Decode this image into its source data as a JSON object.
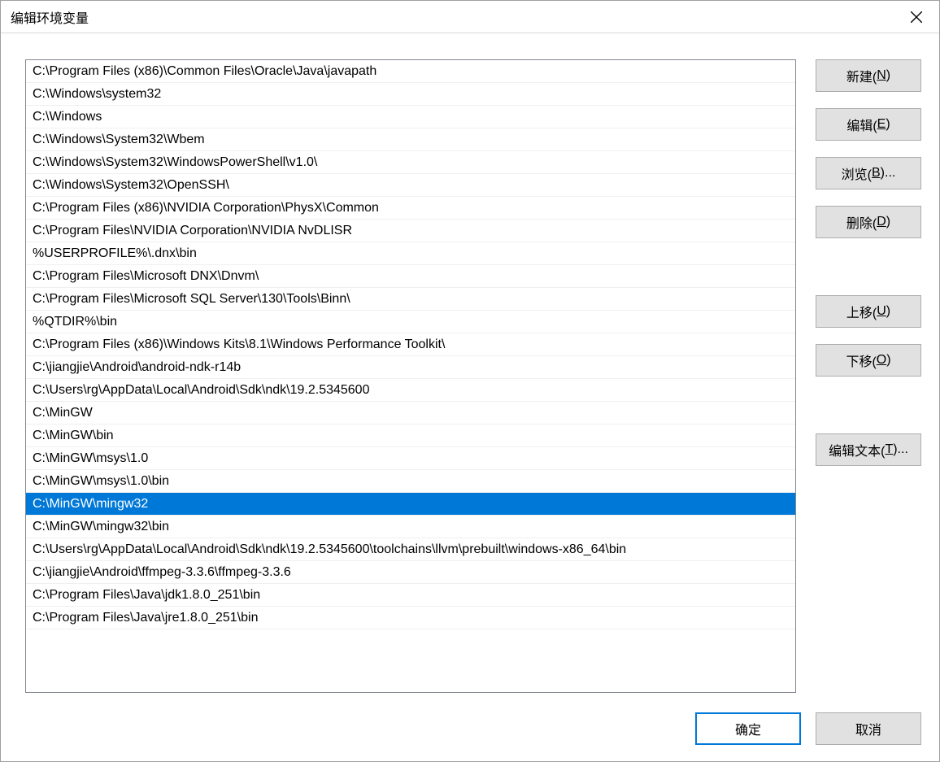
{
  "window": {
    "title": "编辑环境变量"
  },
  "paths": [
    "C:\\Program Files (x86)\\Common Files\\Oracle\\Java\\javapath",
    "C:\\Windows\\system32",
    "C:\\Windows",
    "C:\\Windows\\System32\\Wbem",
    "C:\\Windows\\System32\\WindowsPowerShell\\v1.0\\",
    "C:\\Windows\\System32\\OpenSSH\\",
    "C:\\Program Files (x86)\\NVIDIA Corporation\\PhysX\\Common",
    "C:\\Program Files\\NVIDIA Corporation\\NVIDIA NvDLISR",
    "%USERPROFILE%\\.dnx\\bin",
    "C:\\Program Files\\Microsoft DNX\\Dnvm\\",
    "C:\\Program Files\\Microsoft SQL Server\\130\\Tools\\Binn\\",
    "%QTDIR%\\bin",
    "C:\\Program Files (x86)\\Windows Kits\\8.1\\Windows Performance Toolkit\\",
    "C:\\jiangjie\\Android\\android-ndk-r14b",
    "C:\\Users\\rg\\AppData\\Local\\Android\\Sdk\\ndk\\19.2.5345600",
    "C:\\MinGW",
    "C:\\MinGW\\bin",
    "C:\\MinGW\\msys\\1.0",
    "C:\\MinGW\\msys\\1.0\\bin",
    "C:\\MinGW\\mingw32",
    "C:\\MinGW\\mingw32\\bin",
    "C:\\Users\\rg\\AppData\\Local\\Android\\Sdk\\ndk\\19.2.5345600\\toolchains\\llvm\\prebuilt\\windows-x86_64\\bin",
    "C:\\jiangjie\\Android\\ffmpeg-3.3.6\\ffmpeg-3.3.6",
    "C:\\Program Files\\Java\\jdk1.8.0_251\\bin",
    "C:\\Program Files\\Java\\jre1.8.0_251\\bin"
  ],
  "selected_index": 19,
  "buttons": {
    "new": {
      "pre": "新建(",
      "key": "N",
      "post": ")"
    },
    "edit": {
      "pre": "编辑(",
      "key": "E",
      "post": ")"
    },
    "browse": {
      "pre": "浏览(",
      "key": "B",
      "post": ")..."
    },
    "delete": {
      "pre": "删除(",
      "key": "D",
      "post": ")"
    },
    "moveup": {
      "pre": "上移(",
      "key": "U",
      "post": ")"
    },
    "movedown": {
      "pre": "下移(",
      "key": "O",
      "post": ")"
    },
    "edittext": {
      "pre": "编辑文本(",
      "key": "T",
      "post": ")..."
    },
    "ok": "确定",
    "cancel": "取消"
  }
}
